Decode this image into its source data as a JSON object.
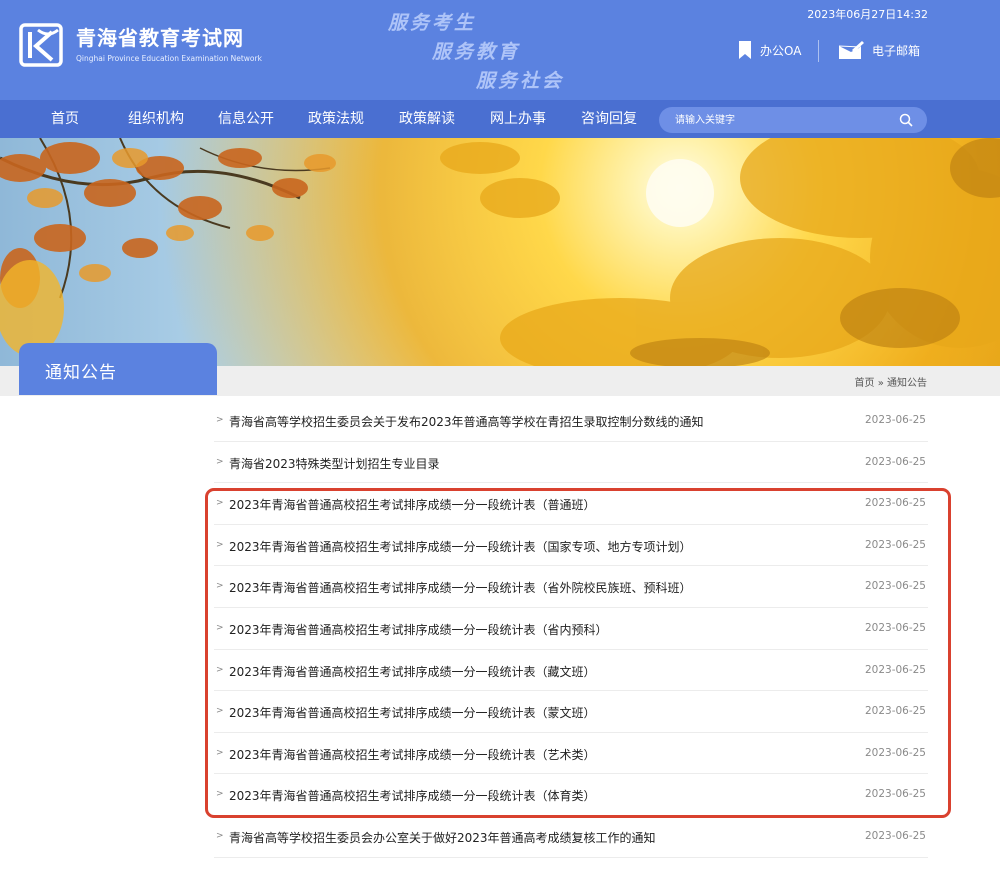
{
  "header": {
    "site_title": "青海省教育考试网",
    "site_subtitle": "Qinghai Province Education Examination Network",
    "slogans": [
      "服务考生",
      "服务教育",
      "服务社会"
    ],
    "datetime": "2023年06月27日14:32",
    "oa_label": "办公OA",
    "mail_label": "电子邮箱",
    "brand_color": "#5b82e0"
  },
  "nav": {
    "items": [
      "首页",
      "组织机构",
      "信息公开",
      "政策法规",
      "政策解读",
      "网上办事",
      "咨询回复"
    ],
    "search_placeholder": "请输入关键字"
  },
  "section": {
    "title": "通知公告",
    "breadcrumb": "首页 » 通知公告"
  },
  "notices": [
    {
      "title": "青海省高等学校招生委员会关于发布2023年普通高等学校在青招生录取控制分数线的通知",
      "date": "2023-06-25"
    },
    {
      "title": "青海省2023特殊类型计划招生专业目录",
      "date": "2023-06-25"
    },
    {
      "title": "2023年青海省普通高校招生考试排序成绩一分一段统计表（普通班）",
      "date": "2023-06-25"
    },
    {
      "title": "2023年青海省普通高校招生考试排序成绩一分一段统计表（国家专项、地方专项计划）",
      "date": "2023-06-25"
    },
    {
      "title": "2023年青海省普通高校招生考试排序成绩一分一段统计表（省外院校民族班、预科班）",
      "date": "2023-06-25"
    },
    {
      "title": "2023年青海省普通高校招生考试排序成绩一分一段统计表（省内预科）",
      "date": "2023-06-25"
    },
    {
      "title": "2023年青海省普通高校招生考试排序成绩一分一段统计表（藏文班）",
      "date": "2023-06-25"
    },
    {
      "title": "2023年青海省普通高校招生考试排序成绩一分一段统计表（蒙文班）",
      "date": "2023-06-25"
    },
    {
      "title": "2023年青海省普通高校招生考试排序成绩一分一段统计表（艺术类）",
      "date": "2023-06-25"
    },
    {
      "title": "2023年青海省普通高校招生考试排序成绩一分一段统计表（体育类）",
      "date": "2023-06-25"
    },
    {
      "title": "青海省高等学校招生委员会办公室关于做好2023年普通高考成绩复核工作的通知",
      "date": "2023-06-25"
    }
  ],
  "icons": {
    "logo": "exam-logo-icon",
    "oa": "bookmark-icon",
    "mail": "mail-pen-icon",
    "search": "search-icon",
    "row_marker": "chevron-right-icon"
  },
  "highlight_color": "#d9412f"
}
